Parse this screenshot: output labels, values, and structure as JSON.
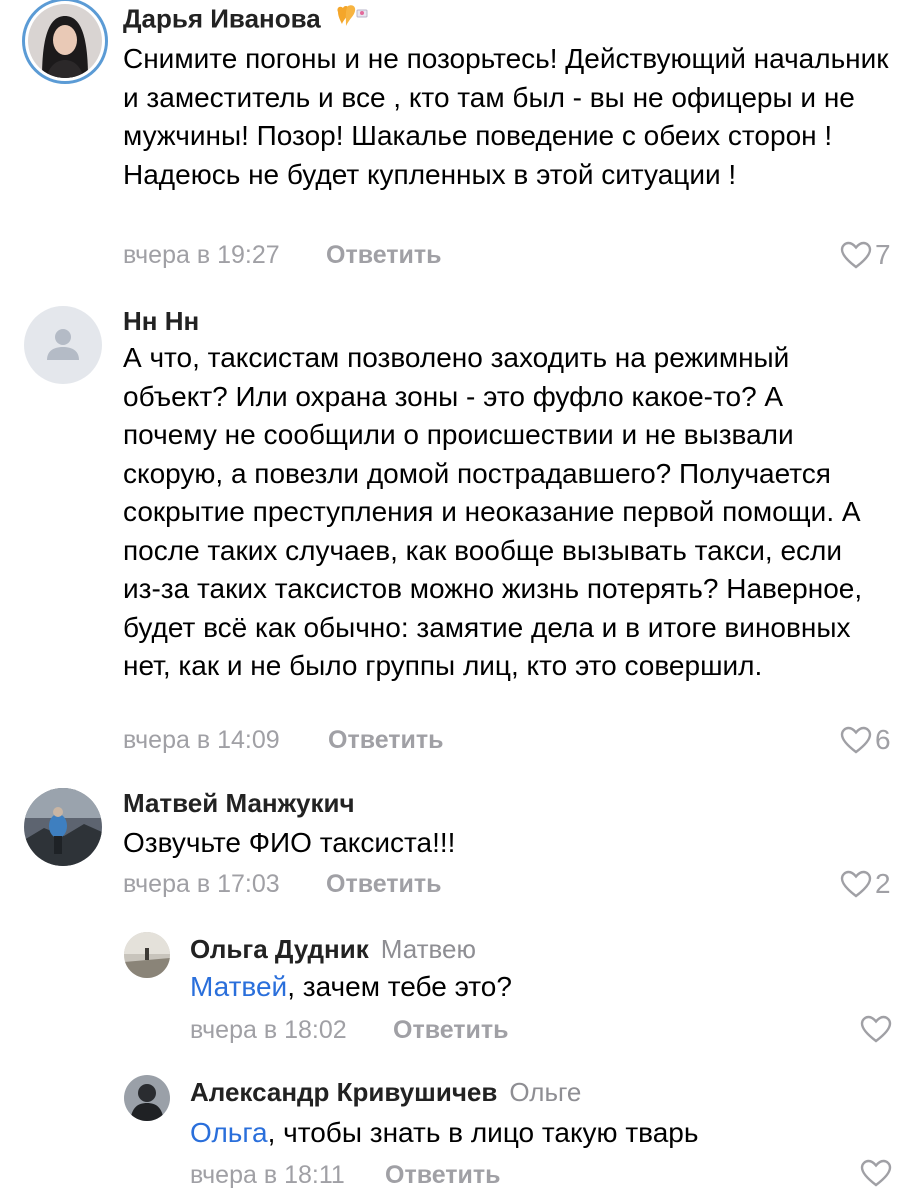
{
  "comments": [
    {
      "author": "Дарья Иванова",
      "text": "Снимите погоны и не позорьтесь! Действующий начальник и заместитель и все , кто там был - вы не офицеры и не мужчины! Позор! Шакалье поведение с обеих сторон ! Надеюсь не будет купленных в этой ситуации !",
      "time": "вчера в 19:27",
      "reply_label": "Ответить",
      "likes": "7",
      "badge_icon": "heart-wings-badge-icon"
    },
    {
      "author": "Нн Нн",
      "text": "А что, таксистам позволено заходить на режимный объект? Или охрана зоны - это фуфло какое-то? А почему не сообщили о происшествии и не вызвали скорую, а повезли домой пострадавшего? Получается сокрытие преступления и неоказание первой помощи. А после таких случаев, как вообще вызывать такси, если из-за таких таксистов можно жизнь потерять? Наверное, будет всё как обычно: замятие дела и в итоге виновных нет, как и не было группы лиц, кто это совершил.",
      "time": "вчера в 14:09",
      "reply_label": "Ответить",
      "likes": "6"
    },
    {
      "author": "Матвей Манжукич",
      "text": "Озвучьте ФИО таксиста!!!",
      "time": "вчера в 17:03",
      "reply_label": "Ответить",
      "likes": "2"
    },
    {
      "author": "Ольга Дудник",
      "reply_to": "Матвею",
      "mention": "Матвей",
      "text": ", зачем тебе это?",
      "time": "вчера в 18:02",
      "reply_label": "Ответить",
      "likes": ""
    },
    {
      "author": "Александр Кривушичев",
      "reply_to": "Ольге",
      "mention": "Ольга",
      "text": ", чтобы знать в лицо такую тварь",
      "time": "вчера в 18:11",
      "reply_label": "Ответить",
      "likes": ""
    }
  ],
  "colors": {
    "meta": "#a0a0a5",
    "mention": "#2a6fdb",
    "avatar_ring": "#5b9bd5"
  }
}
